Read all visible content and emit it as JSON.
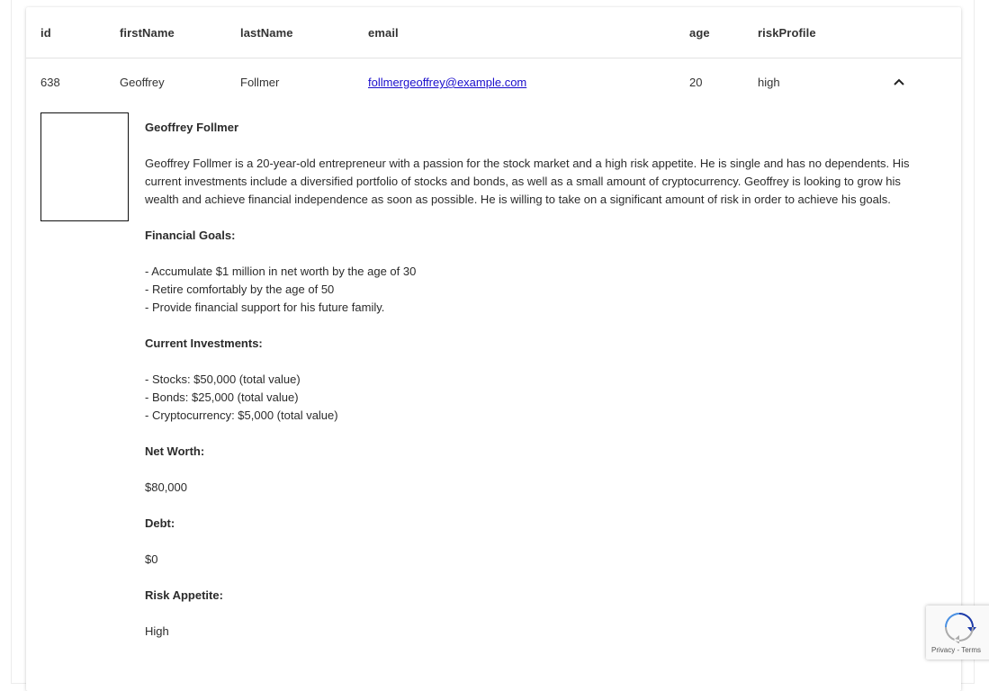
{
  "table": {
    "headers": [
      "id",
      "firstName",
      "lastName",
      "email",
      "age",
      "riskProfile"
    ],
    "row": {
      "id": "638",
      "firstName": "Geoffrey",
      "lastName": "Follmer",
      "email": "follmergeoffrey@example.com",
      "age": "20",
      "riskProfile": "high"
    },
    "expand_icon": "chevron-up-icon"
  },
  "detail": {
    "name": "Geoffrey Follmer",
    "bio": "Geoffrey Follmer is a 20-year-old entrepreneur with a passion for the stock market and a high risk appetite. He is single and has no dependents. His current investments include a diversified portfolio of stocks and bonds, as well as a small amount of cryptocurrency. Geoffrey is looking to grow his wealth and achieve financial independence as soon as possible. He is willing to take on a significant amount of risk in order to achieve his goals.",
    "financial_goals_heading": "Financial Goals:",
    "financial_goals": [
      "- Accumulate $1 million in net worth by the age of 30",
      "- Retire comfortably by the age of 50",
      "- Provide financial support for his future family."
    ],
    "investments_heading": "Current Investments:",
    "investments": [
      "- Stocks: $50,000 (total value)",
      "- Bonds: $25,000 (total value)",
      "- Cryptocurrency: $5,000 (total value)"
    ],
    "net_worth_heading": "Net Worth:",
    "net_worth": "$80,000",
    "debt_heading": "Debt:",
    "debt": "$0",
    "risk_heading": "Risk Appetite:",
    "risk": "High"
  },
  "recaptcha": {
    "privacy": "Privacy",
    "separator": " - ",
    "terms": "Terms"
  },
  "colors": {
    "link": "#1a0dcc",
    "recaptcha_blue": "#4a90e2",
    "recaptcha_dark": "#1c3aa9",
    "recaptcha_grey": "#ababab"
  }
}
